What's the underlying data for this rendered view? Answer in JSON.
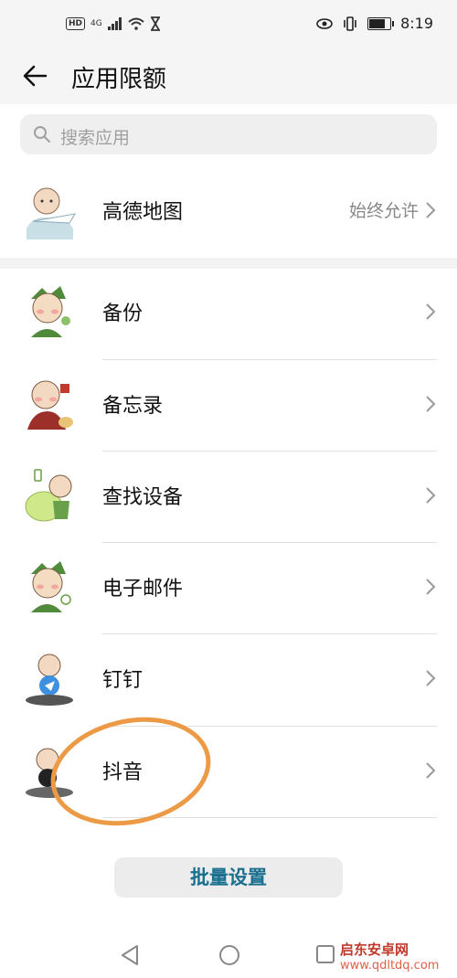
{
  "status_bar": {
    "time": "8:19",
    "network": "4G",
    "hd": "HD"
  },
  "header": {
    "title": "应用限额"
  },
  "search": {
    "placeholder": "搜索应用"
  },
  "top_app": {
    "name": "高德地图",
    "status": "始终允许"
  },
  "apps": [
    {
      "name": "备份"
    },
    {
      "name": "备忘录"
    },
    {
      "name": "查找设备"
    },
    {
      "name": "电子邮件"
    },
    {
      "name": "钉钉"
    },
    {
      "name": "抖音"
    }
  ],
  "bulk_button": "批量设置",
  "watermark": {
    "title": "启东安卓网",
    "url": "www.qdltdq.com"
  },
  "colors": {
    "accent": "#1a6f8f",
    "annotation": "#ec9a45"
  }
}
